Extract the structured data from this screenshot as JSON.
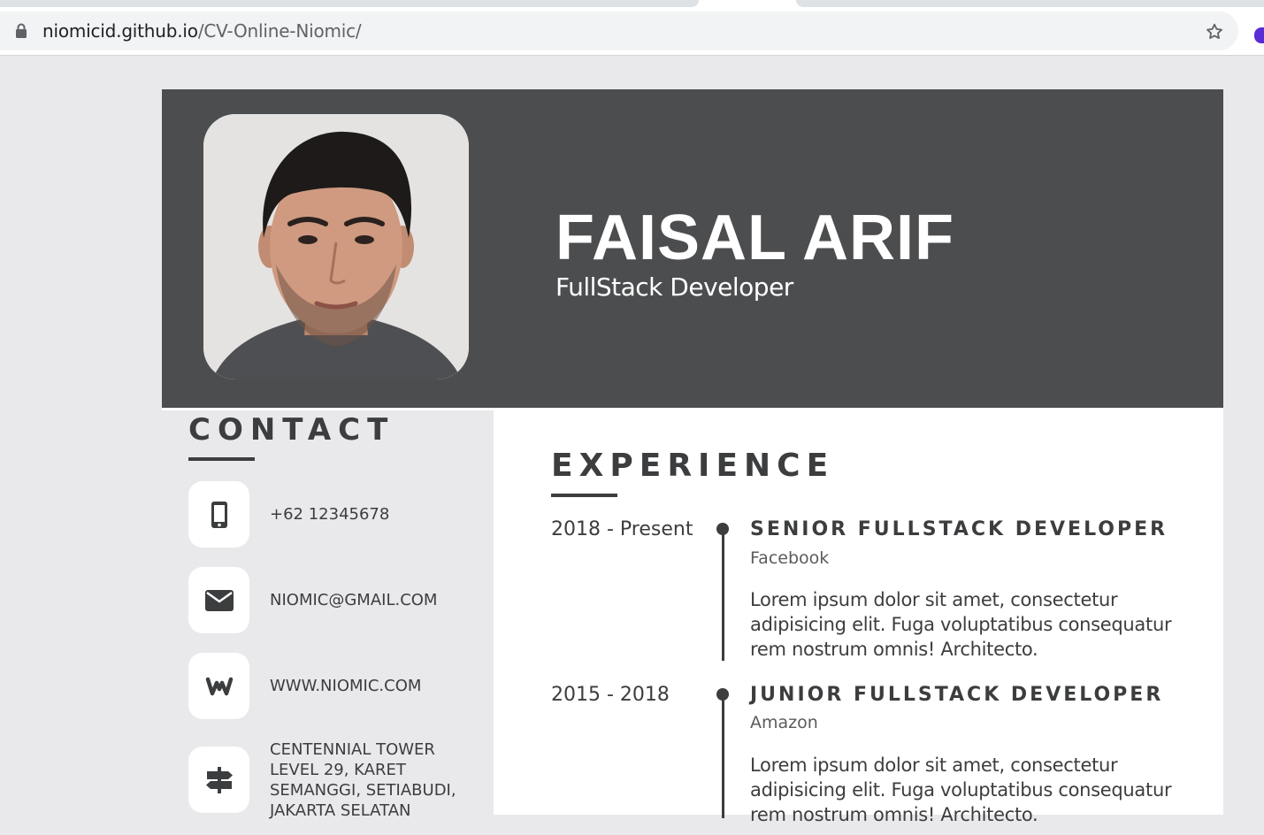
{
  "browser": {
    "url_host": "niomicid.github.io",
    "url_path": "/CV-Online-Niomic/"
  },
  "profile": {
    "name": "FAISAL ARIF",
    "role": "FullStack Developer"
  },
  "contact": {
    "title": "CONTACT",
    "items": [
      {
        "icon": "phone-icon",
        "text": "+62 12345678"
      },
      {
        "icon": "envelope-icon",
        "text": "NIOMIC@GMAIL.COM"
      },
      {
        "icon": "weebly-icon",
        "text": "WWW.NIOMIC.COM"
      },
      {
        "icon": "signpost-icon",
        "lines": [
          "CENTENNIAL TOWER",
          "LEVEL 29, KARET",
          "SEMANGGI, SETIABUDI,",
          "JAKARTA SELATAN"
        ]
      }
    ]
  },
  "experience": {
    "title": "EXPERIENCE",
    "jobs": [
      {
        "date": "2018 - Present",
        "title": "SENIOR FULLSTACK DEVELOPER",
        "company": "Facebook",
        "description": "Lorem ipsum dolor sit amet, consectetur adipisicing elit. Fuga voluptatibus consequatur rem nostrum omnis! Architecto."
      },
      {
        "date": "2015 - 2018",
        "title": "JUNIOR FULLSTACK DEVELOPER",
        "company": "Amazon",
        "description": "Lorem ipsum dolor sit amet, consectetur adipisicing elit. Fuga voluptatibus consequatur rem nostrum omnis! Architecto."
      }
    ]
  },
  "colors": {
    "header_bg": "#4c4d4f",
    "sidebar_bg": "#e9e9eb",
    "text_dark": "#3c3d3f"
  }
}
